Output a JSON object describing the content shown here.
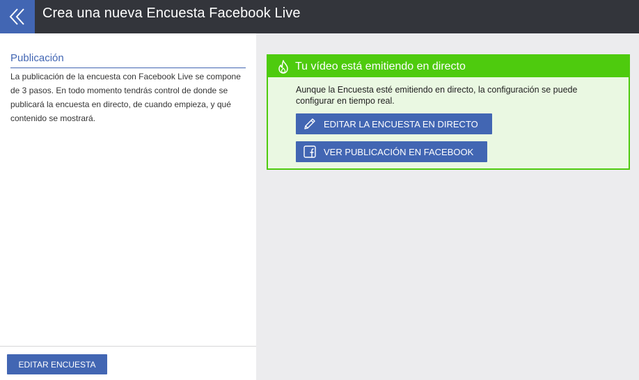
{
  "header": {
    "title": "Crea una nueva Encuesta Facebook Live",
    "back_icon": "double-chevron-left-icon"
  },
  "sidebar": {
    "section_title": "Publicación",
    "description": "La publicación de la encuesta con Facebook Live se compone de 3 pasos. En todo momento tendrás control de donde se publicará la encuesta en directo, de cuando empieza, y qué contenido se mostrará.",
    "footer_button": "EDITAR ENCUESTA"
  },
  "live_panel": {
    "title": "Tu vídeo está emitiendo en directo",
    "title_icon": "flame-icon",
    "message": "Aunque la Encuesta esté emitiendo en directo, la configuración se puede configurar en tiempo real.",
    "edit_button": "EDITAR LA ENCUESTA EN DIRECTO",
    "edit_icon": "pencil-icon",
    "view_button": "VER PUBLICACIÓN EN FACEBOOK",
    "view_icon": "facebook-icon"
  },
  "colors": {
    "topbar": "#33353b",
    "accent": "#4266b3",
    "live_green": "#4ecb0e",
    "live_bg": "#eaf8e2",
    "content_bg": "#ececee"
  }
}
